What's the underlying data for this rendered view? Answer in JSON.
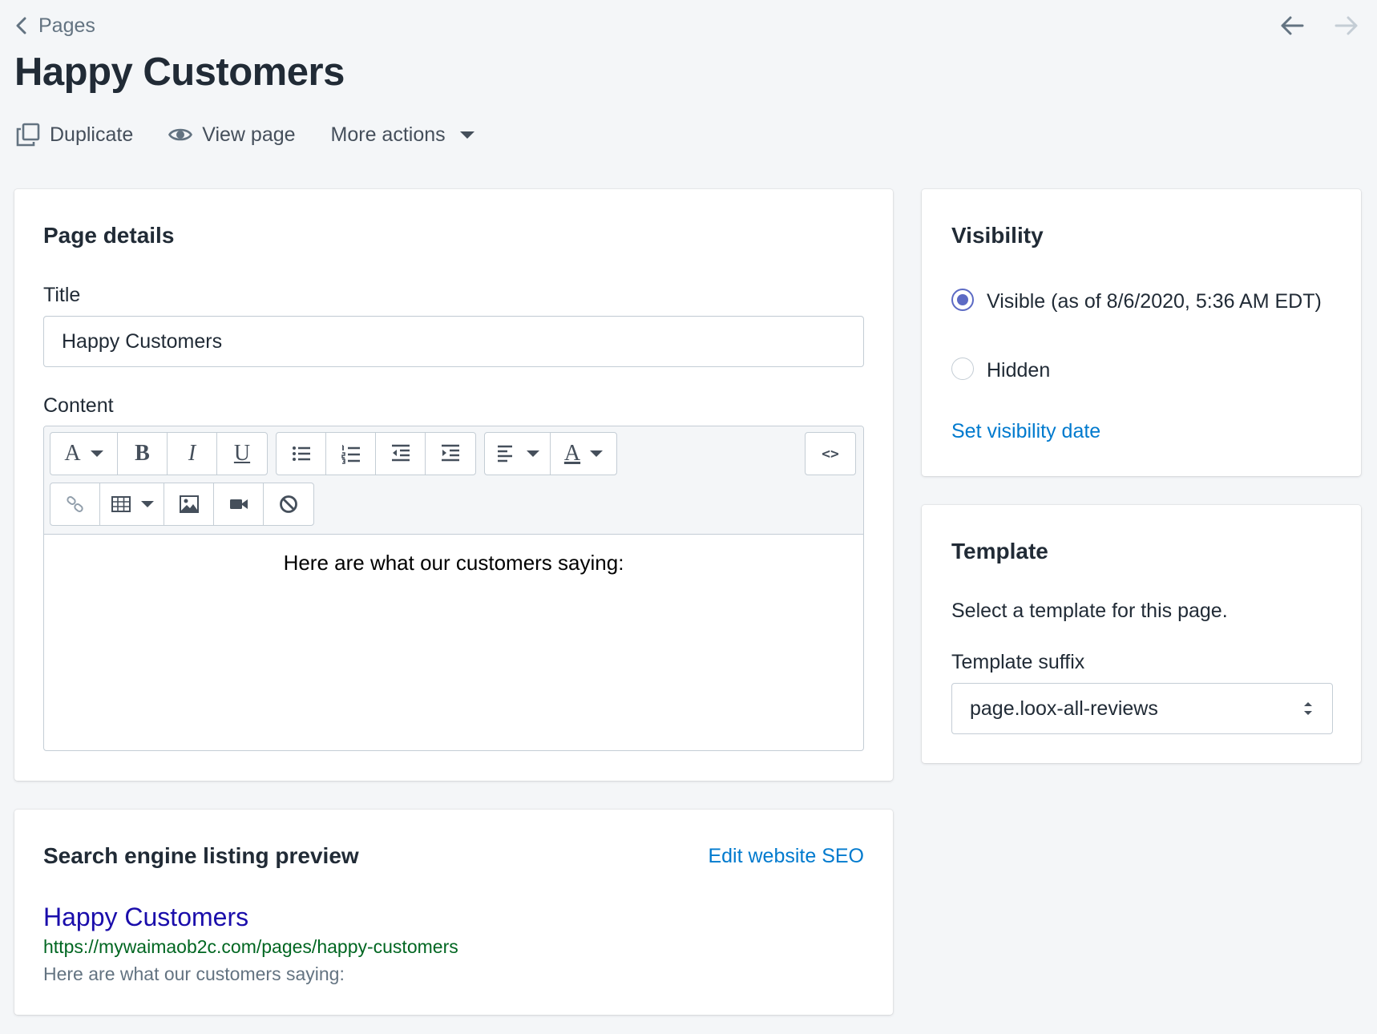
{
  "header": {
    "breadcrumb_label": "Pages",
    "title": "Happy Customers",
    "actions": {
      "duplicate": "Duplicate",
      "view_page": "View page",
      "more_actions": "More actions"
    }
  },
  "page_details": {
    "heading": "Page details",
    "title_label": "Title",
    "title_value": "Happy Customers",
    "content_label": "Content",
    "content_text": "Here are what our customers saying:",
    "toolbar": {
      "font_glyph": "A",
      "bold_glyph": "B",
      "italic_glyph": "I",
      "underline_glyph": "U",
      "color_glyph": "A",
      "html_glyph": "<>"
    }
  },
  "visibility": {
    "heading": "Visibility",
    "options": [
      {
        "label": "Visible (as of 8/6/2020, 5:36 AM EDT)",
        "selected": true
      },
      {
        "label": "Hidden",
        "selected": false
      }
    ],
    "set_date_link": "Set visibility date"
  },
  "template": {
    "heading": "Template",
    "description": "Select a template for this page.",
    "suffix_label": "Template suffix",
    "suffix_value": "page.loox-all-reviews"
  },
  "seo": {
    "heading": "Search engine listing preview",
    "edit_link": "Edit website SEO",
    "preview_title": "Happy Customers",
    "preview_url": "https://mywaimaob2c.com/pages/happy-customers",
    "preview_description": "Here are what our customers saying:"
  },
  "colors": {
    "accent_radio": "#5c6ac4",
    "link": "#007ace",
    "seo_title": "#1a0dab",
    "seo_url": "#006621"
  }
}
